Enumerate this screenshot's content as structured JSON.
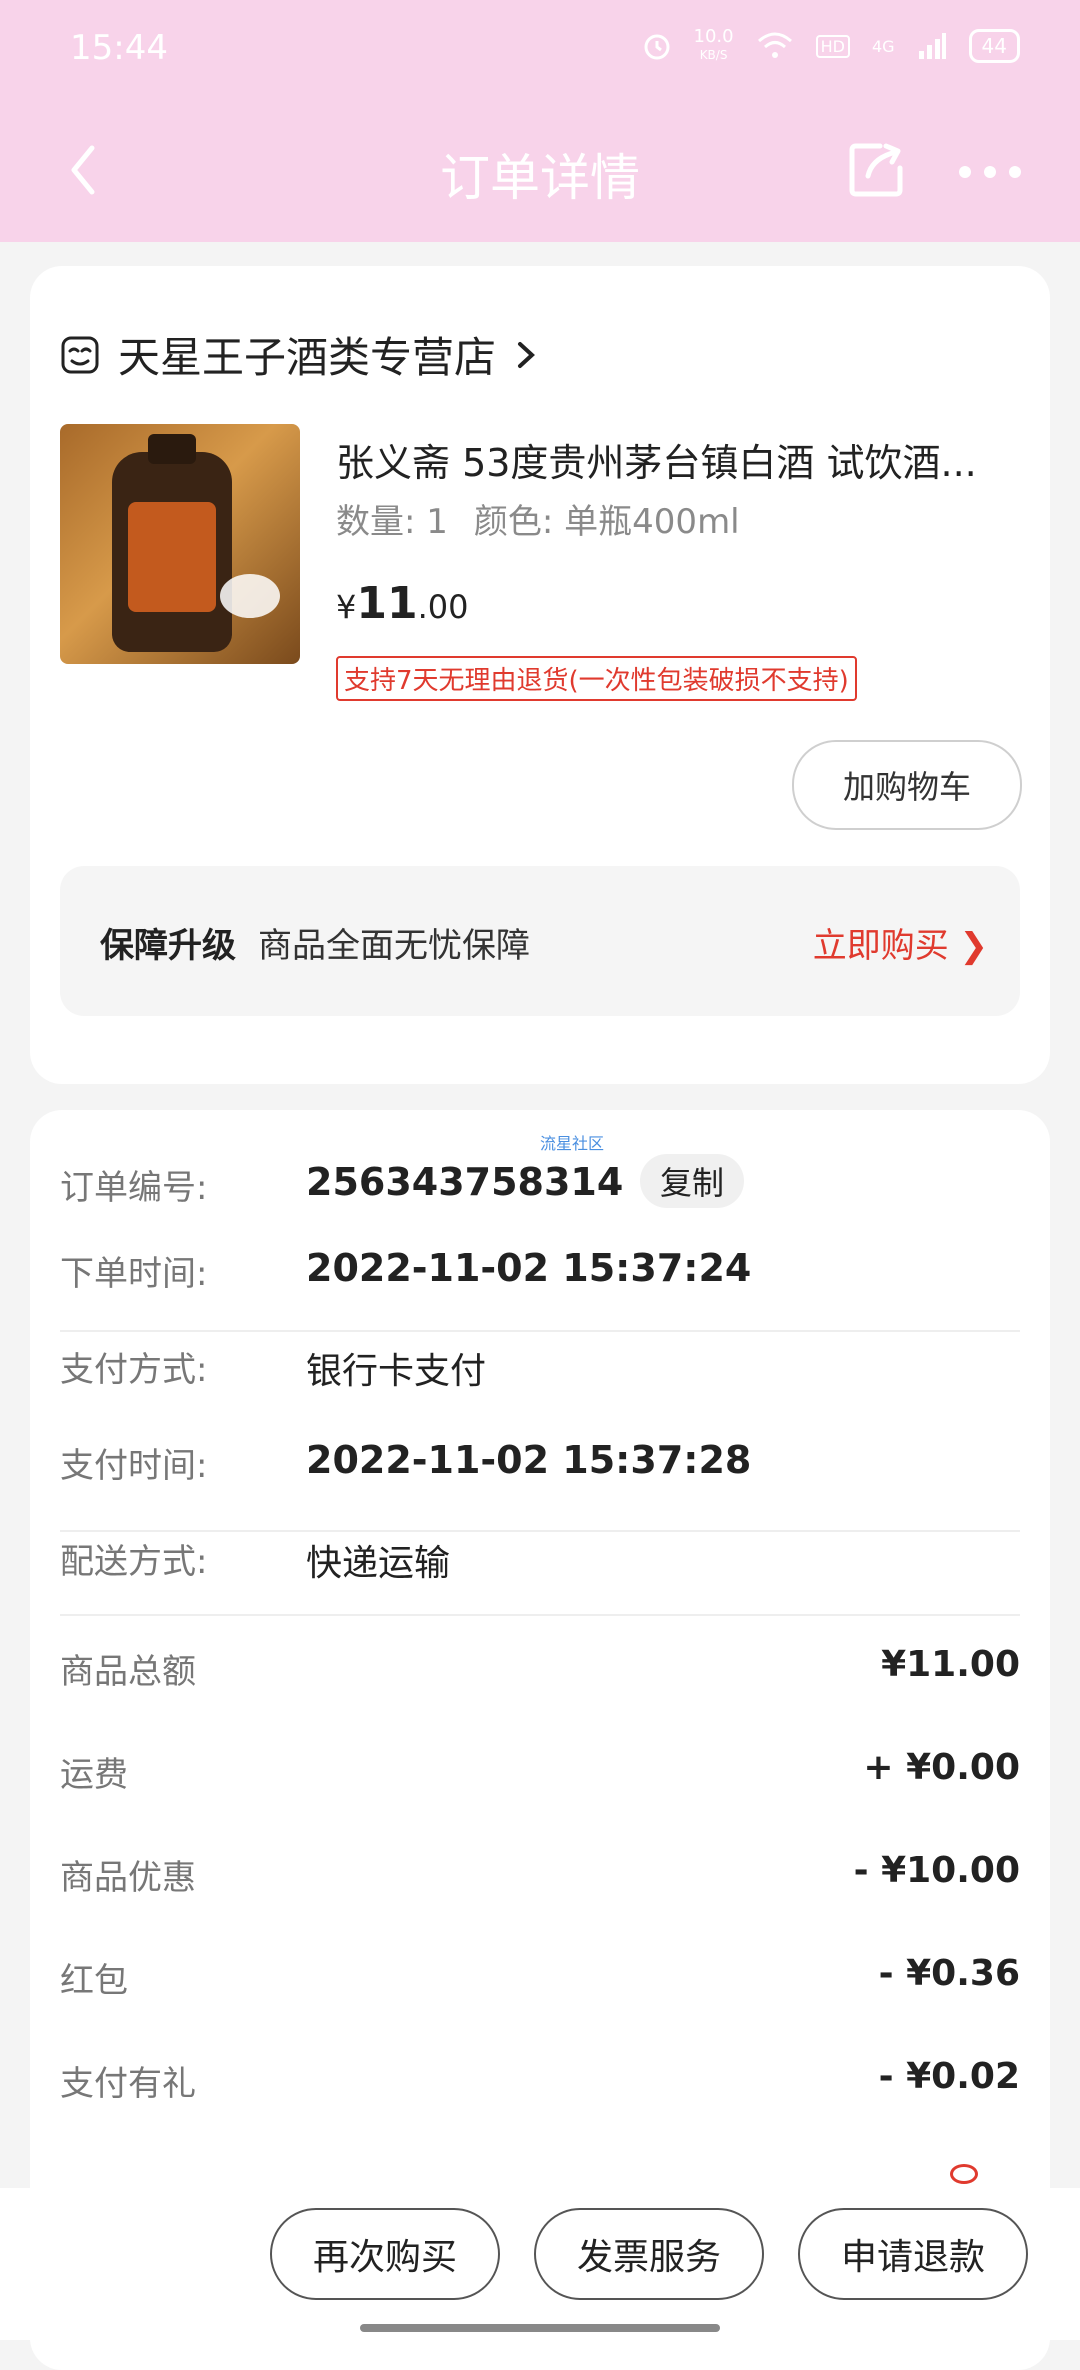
{
  "status_bar": {
    "time": "15:44",
    "net_speed": "10.0",
    "net_speed_unit": "KB/S",
    "hd_label": "HD",
    "signal_label": "4G",
    "battery": "44"
  },
  "header": {
    "title": "订单详情",
    "icons": [
      "back-icon",
      "share-icon",
      "more-icon"
    ]
  },
  "store": {
    "name": "天星王子酒类专营店"
  },
  "product": {
    "title": "张义斋 53度贵州茅台镇白酒 试饮酒...",
    "quantity_label": "数量: 1",
    "color_label": "颜色: 单瓶400ml",
    "price_symbol": "¥",
    "price_int": "11",
    "price_dec": ".00",
    "return_policy": "支持7天无理由退货(一次性包装破损不支持)",
    "add_cart_label": "加购物车"
  },
  "protection": {
    "title": "保障升级",
    "desc": "商品全面无忧保障",
    "buy_label": "立即购买 ❯"
  },
  "order_info": {
    "order_no_label": "订单编号:",
    "order_no": "256343758314",
    "copy_label": "复制",
    "watermark": "流星社区",
    "order_time_label": "下单时间:",
    "order_time": "2022-11-02 15:37:24",
    "pay_method_label": "支付方式:",
    "pay_method": "银行卡支付",
    "pay_time_label": "支付时间:",
    "pay_time": "2022-11-02 15:37:28",
    "delivery_label": "配送方式:",
    "delivery": "快递运输"
  },
  "amounts": [
    {
      "label": "商品总额",
      "value": "¥11.00"
    },
    {
      "label": "运费",
      "value": "+ ¥0.00"
    },
    {
      "label": "商品优惠",
      "value": "- ¥10.00"
    },
    {
      "label": "红包",
      "value": "- ¥0.36"
    },
    {
      "label": "支付有礼",
      "value": "- ¥0.02"
    }
  ],
  "bottom_actions": {
    "rebuy": "再次购买",
    "invoice": "发票服务",
    "refund": "申请退款"
  },
  "colors": {
    "header_bg": "#f8d3ea",
    "accent_red": "#e03a2e"
  }
}
